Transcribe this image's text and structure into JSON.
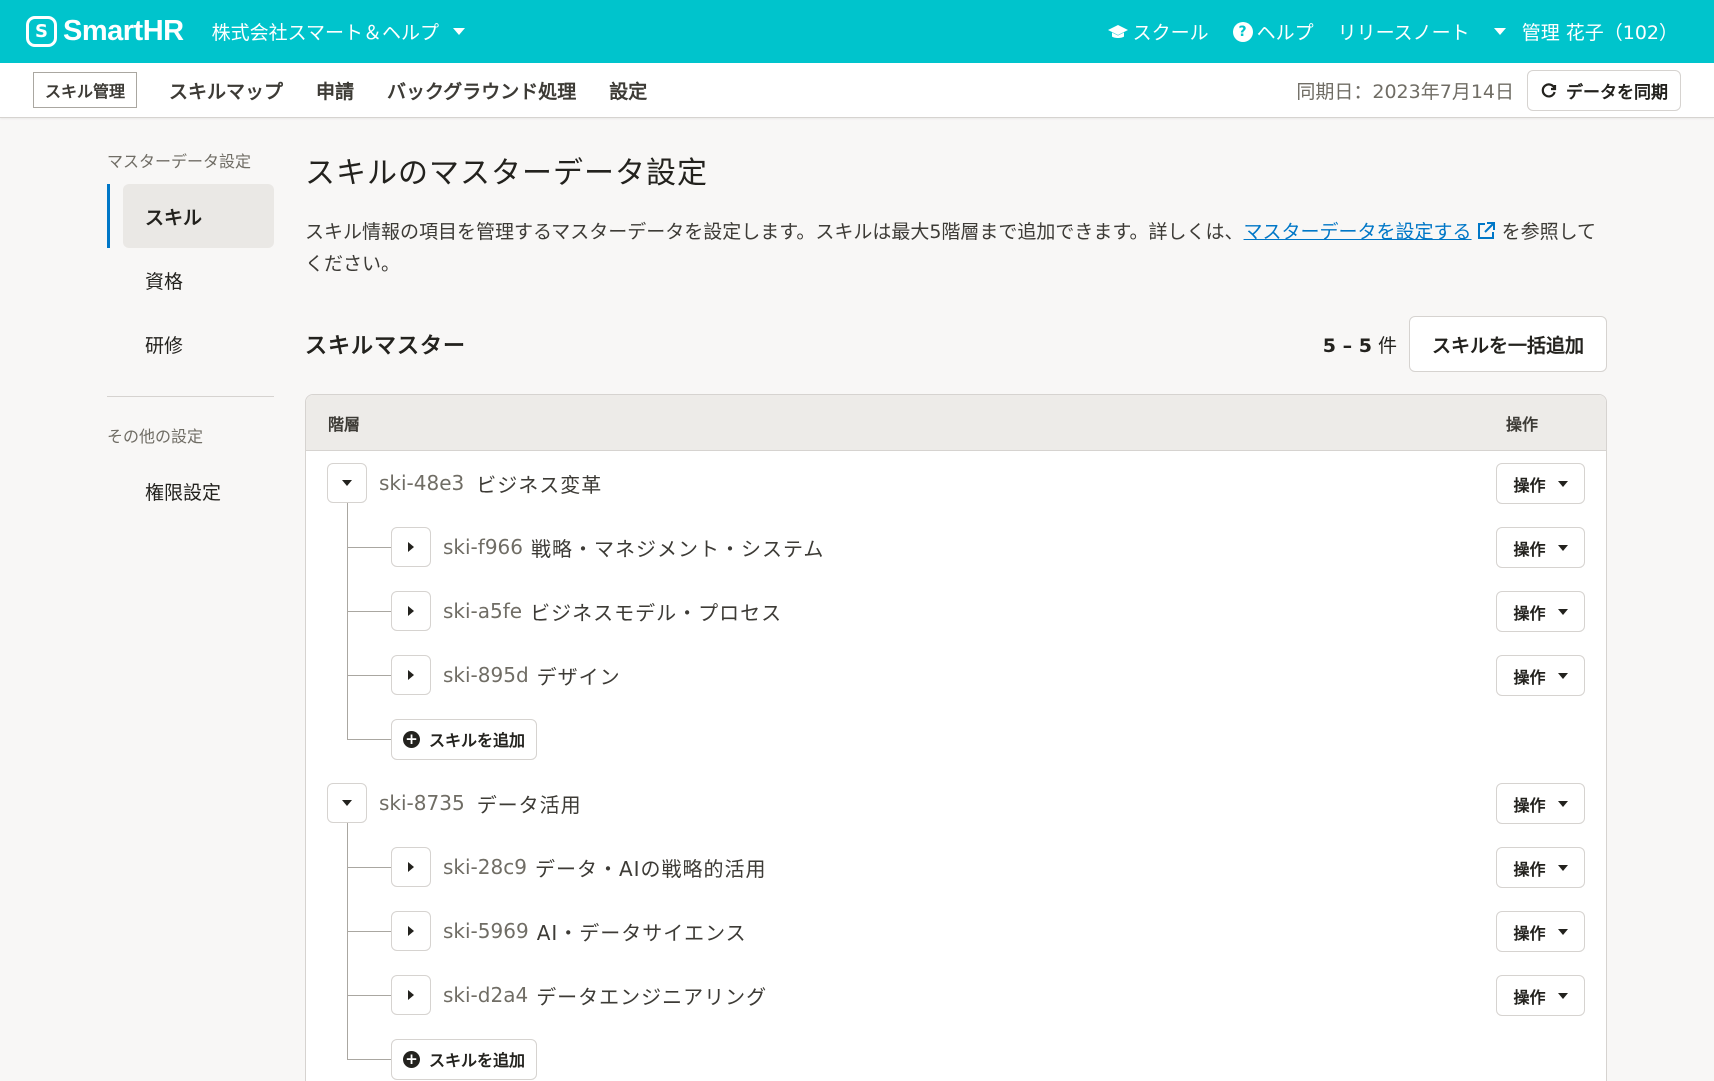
{
  "header": {
    "logo_mark": "S",
    "logo_text": "SmartHR",
    "company": "株式会社スマート＆ヘルプ",
    "school": "スクール",
    "help": "ヘルプ",
    "release_notes": "リリースノート",
    "user": "管理 花子（102）"
  },
  "subnav": {
    "product": "スキル管理",
    "tabs": [
      "スキルマップ",
      "申請",
      "バックグラウンド処理",
      "設定"
    ],
    "sync_date": "同期日：2023年7月14日",
    "sync_button": "データを同期"
  },
  "sidebar": {
    "heading1": "マスターデータ設定",
    "items": [
      "スキル",
      "資格",
      "研修"
    ],
    "heading2": "その他の設定",
    "items2": [
      "権限設定"
    ]
  },
  "main": {
    "title": "スキルのマスターデータ設定",
    "desc_before": "スキル情報の項目を管理するマスターデータを設定します。スキルは最大5階層まで追加できます。詳しくは、",
    "desc_link": "マスターデータを設定する",
    "desc_after": "を参照してください。",
    "section_title": "スキルマスター",
    "count_range": "5 – 5",
    "count_unit": "件",
    "bulk_add": "スキルを一括追加",
    "col_hierarchy": "階層",
    "col_ops": "操作",
    "op_label": "操作",
    "add_skill": "スキルを追加"
  },
  "tree": [
    {
      "id": "ski-48e3",
      "name": "ビジネス変革",
      "children": [
        {
          "id": "ski-f966",
          "name": "戦略・マネジメント・システム"
        },
        {
          "id": "ski-a5fe",
          "name": "ビジネスモデル・プロセス"
        },
        {
          "id": "ski-895d",
          "name": "デザイン"
        }
      ]
    },
    {
      "id": "ski-8735",
      "name": "データ活用",
      "children": [
        {
          "id": "ski-28c9",
          "name": "データ・AIの戦略的活用"
        },
        {
          "id": "ski-5969",
          "name": "AI・データサイエンス"
        },
        {
          "id": "ski-d2a4",
          "name": "データエンジニアリング"
        }
      ]
    }
  ]
}
